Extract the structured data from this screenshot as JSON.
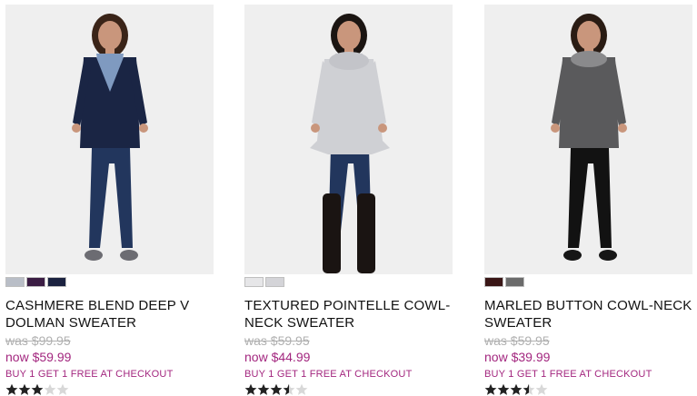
{
  "products": [
    {
      "title": "CASHMERE BLEND DEEP V DOLMAN SWEATER",
      "was": "was $99.95",
      "now": "now $59.99",
      "promo": "BUY 1 GET 1 FREE AT CHECKOUT",
      "rating": 3,
      "swatch_colors": [
        "#b9bec7",
        "#3b1d44",
        "#1b2240"
      ],
      "outfit": {
        "top": "#1a2544",
        "inner": "#7f9ac0",
        "pants": "#22365d",
        "shoes": "#6c6c72",
        "skin": "#c9967c",
        "hair": "#3a2418"
      }
    },
    {
      "title": "TEXTURED POINTELLE COWL-NECK SWEATER",
      "was": "was $59.95",
      "now": "now $44.99",
      "promo": "BUY 1 GET 1 FREE AT CHECKOUT",
      "rating": 3.5,
      "swatch_colors": [
        "#e6e6e8",
        "#d4d4d8"
      ],
      "outfit": {
        "top": "#cfd0d4",
        "inner": "#c3c4c9",
        "pants": "#22365d",
        "shoes": "#1a1412",
        "skin": "#c9967c",
        "hair": "#1b1512"
      }
    },
    {
      "title": "MARLED BUTTON COWL-NECK SWEATER",
      "was": "was $59.95",
      "now": "now $39.99",
      "promo": "BUY 1 GET 1 FREE AT CHECKOUT",
      "rating": 3.5,
      "swatch_colors": [
        "#3a1616",
        "#6b6b6b"
      ],
      "outfit": {
        "top": "#5a5a5c",
        "inner": "#8a8a8c",
        "pants": "#121212",
        "shoes": "#161616",
        "skin": "#c9967c",
        "hair": "#2a1c14"
      }
    }
  ],
  "colors": {
    "accent": "#a3277f",
    "was_price": "#b0b0b0",
    "star_filled": "#222222",
    "star_empty": "#d8d8d8"
  }
}
